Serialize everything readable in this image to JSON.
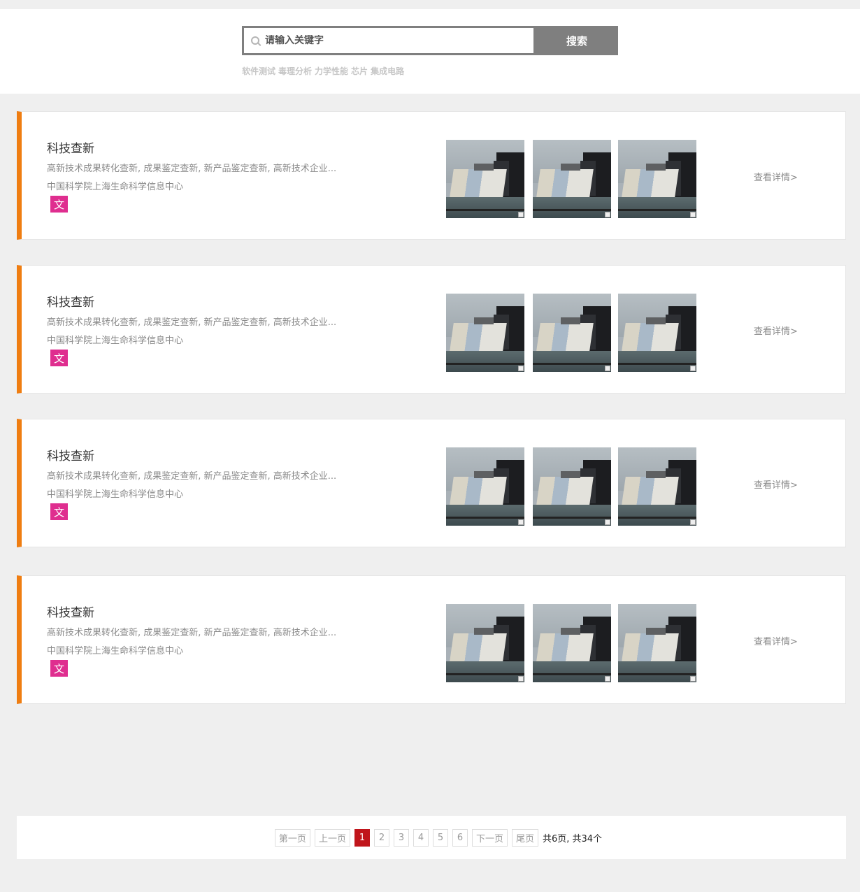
{
  "search": {
    "placeholder": "请输入关键字",
    "button_label": "搜索",
    "hot_keywords": [
      "软件测试",
      "毒理分析",
      "力学性能",
      "芯片",
      "集成电路"
    ]
  },
  "cards": [
    {
      "title": "科技查新",
      "description": "高新技术成果转化查新, 成果鉴定查新, 新产品鉴定查新, 高新技术企业...",
      "organization": "中国科学院上海生命科学信息中心",
      "badge": "文",
      "link": "查看详情>"
    },
    {
      "title": "科技查新",
      "description": "高新技术成果转化查新, 成果鉴定查新, 新产品鉴定查新, 高新技术企业...",
      "organization": "中国科学院上海生命科学信息中心",
      "badge": "文",
      "link": "查看详情>"
    },
    {
      "title": "科技查新",
      "description": "高新技术成果转化查新, 成果鉴定查新, 新产品鉴定查新, 高新技术企业...",
      "organization": "中国科学院上海生命科学信息中心",
      "badge": "文",
      "link": "查看详情>"
    },
    {
      "title": "科技查新",
      "description": "高新技术成果转化查新, 成果鉴定查新, 新产品鉴定查新, 高新技术企业...",
      "organization": "中国科学院上海生命科学信息中心",
      "badge": "文",
      "link": "查看详情>"
    }
  ],
  "pagination": {
    "first": "第一页",
    "prev": "上一页",
    "pages": [
      "1",
      "2",
      "3",
      "4",
      "5",
      "6"
    ],
    "current": "1",
    "next": "下一页",
    "last": "尾页",
    "summary": "共6页, 共34个"
  },
  "colors": {
    "accent": "#ef7d11",
    "badge": "#df2e8f",
    "active_page": "#c0151b",
    "search_button": "#7f7f7f"
  }
}
